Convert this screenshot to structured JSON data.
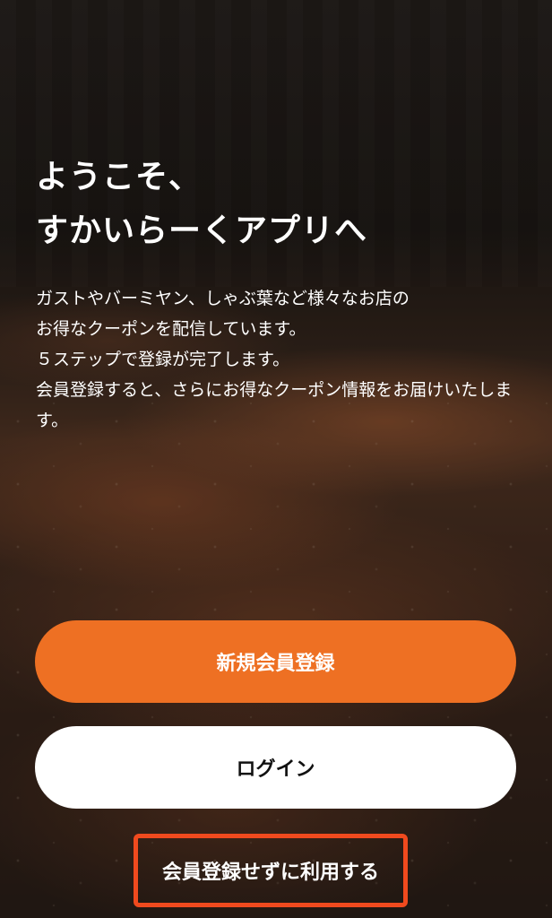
{
  "welcome": {
    "title_line1": "ようこそ、",
    "title_line2": "すかいらーくアプリへ"
  },
  "description": {
    "line1": "ガストやバーミヤン、しゃぶ葉など様々なお店の",
    "line2": "お得なクーポンを配信しています。",
    "line3": "５ステップで登録が完了します。",
    "line4": "会員登録すると、さらにお得なクーポン情報をお届けいたします。"
  },
  "actions": {
    "register_label": "新規会員登録",
    "login_label": "ログイン",
    "guest_label": "会員登録せずに利用する"
  },
  "colors": {
    "accent": "#ee7023",
    "highlight_border": "#f04a1e"
  }
}
